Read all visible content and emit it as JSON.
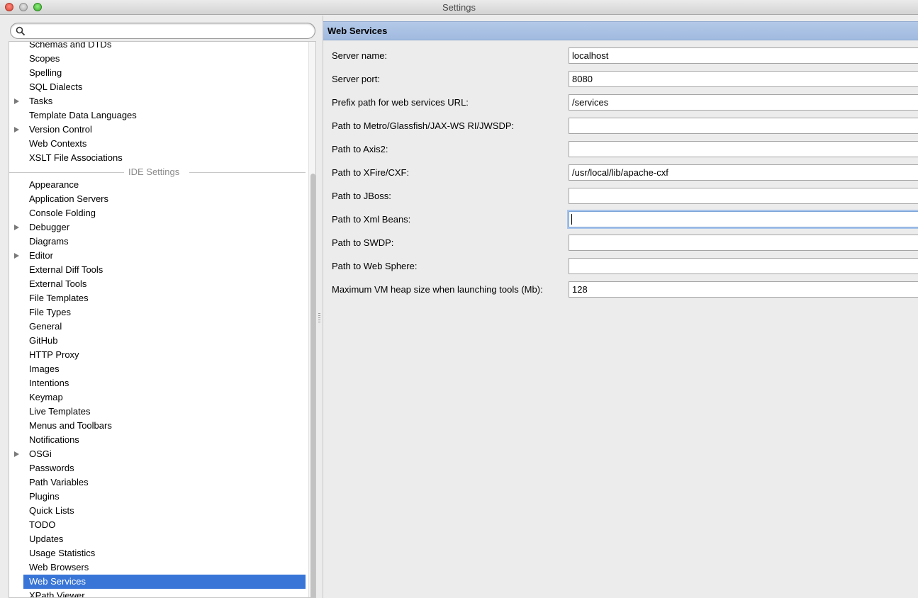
{
  "window": {
    "title": "Settings"
  },
  "search": {
    "value": "",
    "placeholder": ""
  },
  "tree": {
    "items_top": [
      {
        "label": "Schemas and DTDs",
        "expandable": false
      },
      {
        "label": "Scopes",
        "expandable": false
      },
      {
        "label": "Spelling",
        "expandable": false
      },
      {
        "label": "SQL Dialects",
        "expandable": false
      },
      {
        "label": "Tasks",
        "expandable": true
      },
      {
        "label": "Template Data Languages",
        "expandable": false
      },
      {
        "label": "Version Control",
        "expandable": true
      },
      {
        "label": "Web Contexts",
        "expandable": false
      },
      {
        "label": "XSLT File Associations",
        "expandable": false
      }
    ],
    "section_label": "IDE Settings",
    "items_ide": [
      {
        "label": "Appearance",
        "expandable": false
      },
      {
        "label": "Application Servers",
        "expandable": false
      },
      {
        "label": "Console Folding",
        "expandable": false
      },
      {
        "label": "Debugger",
        "expandable": true
      },
      {
        "label": "Diagrams",
        "expandable": false
      },
      {
        "label": "Editor",
        "expandable": true
      },
      {
        "label": "External Diff Tools",
        "expandable": false
      },
      {
        "label": "External Tools",
        "expandable": false
      },
      {
        "label": "File Templates",
        "expandable": false
      },
      {
        "label": "File Types",
        "expandable": false
      },
      {
        "label": "General",
        "expandable": false
      },
      {
        "label": "GitHub",
        "expandable": false
      },
      {
        "label": "HTTP Proxy",
        "expandable": false
      },
      {
        "label": "Images",
        "expandable": false
      },
      {
        "label": "Intentions",
        "expandable": false
      },
      {
        "label": "Keymap",
        "expandable": false
      },
      {
        "label": "Live Templates",
        "expandable": false
      },
      {
        "label": "Menus and Toolbars",
        "expandable": false
      },
      {
        "label": "Notifications",
        "expandable": false
      },
      {
        "label": "OSGi",
        "expandable": true
      },
      {
        "label": "Passwords",
        "expandable": false
      },
      {
        "label": "Path Variables",
        "expandable": false
      },
      {
        "label": "Plugins",
        "expandable": false
      },
      {
        "label": "Quick Lists",
        "expandable": false
      },
      {
        "label": "TODO",
        "expandable": false
      },
      {
        "label": "Updates",
        "expandable": false
      },
      {
        "label": "Usage Statistics",
        "expandable": false
      },
      {
        "label": "Web Browsers",
        "expandable": false
      },
      {
        "label": "Web Services",
        "expandable": false,
        "selected": true
      },
      {
        "label": "XPath Viewer",
        "expandable": false
      }
    ]
  },
  "panel": {
    "title": "Web Services",
    "fields": [
      {
        "label": "Server name:",
        "value": "localhost"
      },
      {
        "label": "Server port:",
        "value": "8080"
      },
      {
        "label": "Prefix path for web services URL:",
        "value": "/services"
      },
      {
        "label": "Path to Metro/Glassfish/JAX-WS RI/JWSDP:",
        "value": ""
      },
      {
        "label": "Path to Axis2:",
        "value": ""
      },
      {
        "label": "Path to XFire/CXF:",
        "value": "/usr/local/lib/apache-cxf"
      },
      {
        "label": "Path to JBoss:",
        "value": ""
      },
      {
        "label": "Path to Xml Beans:",
        "value": "",
        "focused": true
      },
      {
        "label": "Path to SWDP:",
        "value": ""
      },
      {
        "label": "Path to Web Sphere:",
        "value": ""
      },
      {
        "label": "Maximum VM heap size when launching tools (Mb):",
        "value": "128"
      }
    ]
  },
  "colors": {
    "selection": "#3875d7",
    "header": "#a0badf",
    "focus_ring": "#a9c5eb"
  }
}
